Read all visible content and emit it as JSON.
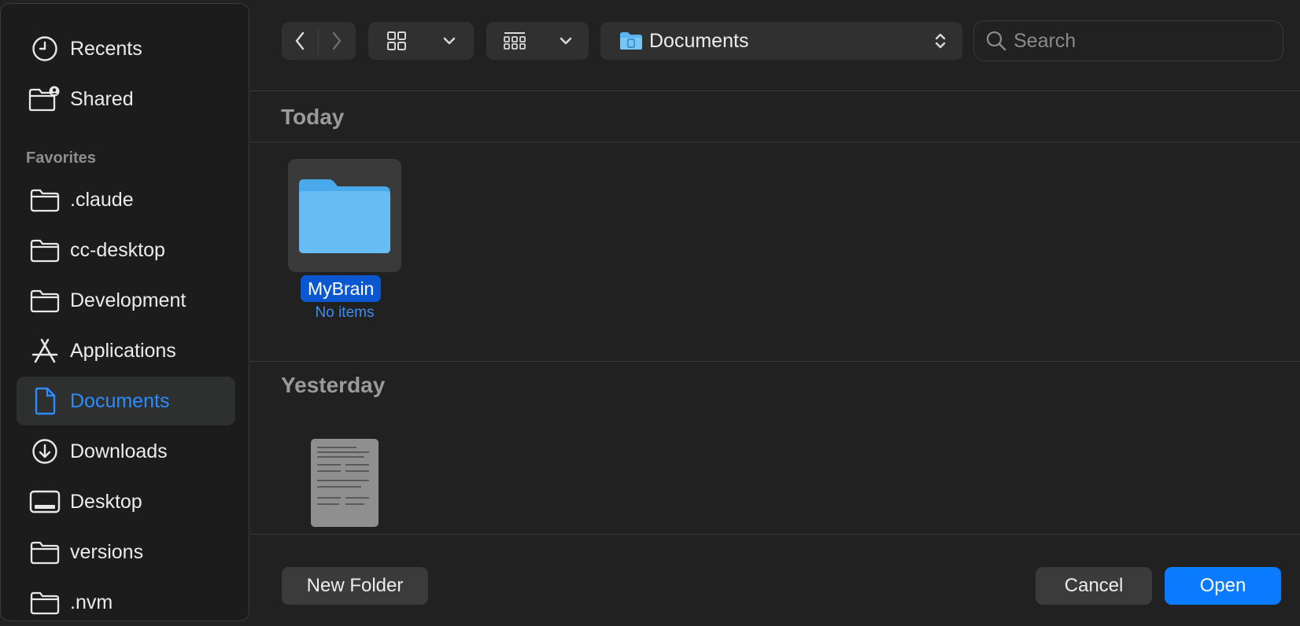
{
  "sidebar": {
    "top_items": [
      {
        "label": "Recents",
        "icon": "clock-icon"
      },
      {
        "label": "Shared",
        "icon": "shared-folder-icon"
      }
    ],
    "section_title": "Favorites",
    "favorites": [
      {
        "label": ".claude",
        "icon": "folder-icon"
      },
      {
        "label": "cc-desktop",
        "icon": "folder-icon"
      },
      {
        "label": "Development",
        "icon": "folder-icon"
      },
      {
        "label": "Applications",
        "icon": "applications-icon"
      },
      {
        "label": "Documents",
        "icon": "document-icon",
        "selected": true
      },
      {
        "label": "Downloads",
        "icon": "download-icon"
      },
      {
        "label": "Desktop",
        "icon": "desktop-icon"
      },
      {
        "label": "versions",
        "icon": "folder-icon"
      },
      {
        "label": ".nvm",
        "icon": "folder-icon"
      }
    ]
  },
  "toolbar": {
    "location": "Documents",
    "search_placeholder": "Search"
  },
  "content": {
    "groups": [
      {
        "title": "Today",
        "items": [
          {
            "name": "MyBrain",
            "subtitle": "No items",
            "type": "folder",
            "selected": true
          }
        ]
      },
      {
        "title": "Yesterday",
        "items": [
          {
            "type": "document"
          }
        ]
      }
    ]
  },
  "footer": {
    "new_folder_label": "New Folder",
    "cancel_label": "Cancel",
    "open_label": "Open"
  },
  "colors": {
    "accent": "#0a7bff",
    "selection": "#0a57d0",
    "folder": "#5ab4f0"
  }
}
